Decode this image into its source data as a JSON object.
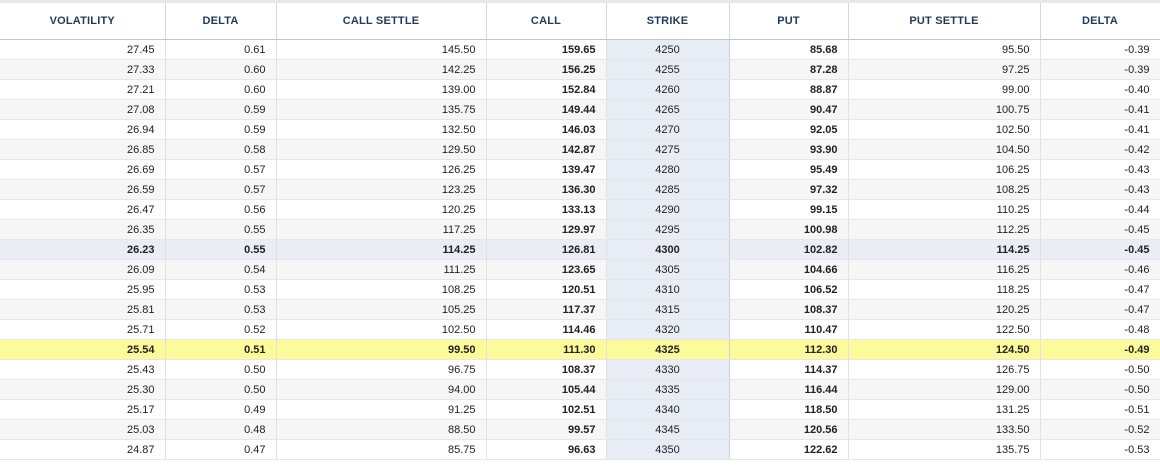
{
  "columns": [
    "VOLATILITY",
    "DELTA",
    "CALL SETTLE",
    "CALL",
    "STRIKE",
    "PUT",
    "PUT SETTLE",
    "DELTA"
  ],
  "rows": [
    {
      "volatility": "27.45",
      "call_delta": "0.61",
      "call_settle": "145.50",
      "call": "159.65",
      "strike": "4250",
      "put": "85.68",
      "put_settle": "95.50",
      "put_delta": "-0.39"
    },
    {
      "volatility": "27.33",
      "call_delta": "0.60",
      "call_settle": "142.25",
      "call": "156.25",
      "strike": "4255",
      "put": "87.28",
      "put_settle": "97.25",
      "put_delta": "-0.39"
    },
    {
      "volatility": "27.21",
      "call_delta": "0.60",
      "call_settle": "139.00",
      "call": "152.84",
      "strike": "4260",
      "put": "88.87",
      "put_settle": "99.00",
      "put_delta": "-0.40"
    },
    {
      "volatility": "27.08",
      "call_delta": "0.59",
      "call_settle": "135.75",
      "call": "149.44",
      "strike": "4265",
      "put": "90.47",
      "put_settle": "100.75",
      "put_delta": "-0.41"
    },
    {
      "volatility": "26.94",
      "call_delta": "0.59",
      "call_settle": "132.50",
      "call": "146.03",
      "strike": "4270",
      "put": "92.05",
      "put_settle": "102.50",
      "put_delta": "-0.41"
    },
    {
      "volatility": "26.85",
      "call_delta": "0.58",
      "call_settle": "129.50",
      "call": "142.87",
      "strike": "4275",
      "put": "93.90",
      "put_settle": "104.50",
      "put_delta": "-0.42"
    },
    {
      "volatility": "26.69",
      "call_delta": "0.57",
      "call_settle": "126.25",
      "call": "139.47",
      "strike": "4280",
      "put": "95.49",
      "put_settle": "106.25",
      "put_delta": "-0.43"
    },
    {
      "volatility": "26.59",
      "call_delta": "0.57",
      "call_settle": "123.25",
      "call": "136.30",
      "strike": "4285",
      "put": "97.32",
      "put_settle": "108.25",
      "put_delta": "-0.43"
    },
    {
      "volatility": "26.47",
      "call_delta": "0.56",
      "call_settle": "120.25",
      "call": "133.13",
      "strike": "4290",
      "put": "99.15",
      "put_settle": "110.25",
      "put_delta": "-0.44"
    },
    {
      "volatility": "26.35",
      "call_delta": "0.55",
      "call_settle": "117.25",
      "call": "129.97",
      "strike": "4295",
      "put": "100.98",
      "put_settle": "112.25",
      "put_delta": "-0.45"
    },
    {
      "volatility": "26.23",
      "call_delta": "0.55",
      "call_settle": "114.25",
      "call": "126.81",
      "strike": "4300",
      "put": "102.82",
      "put_settle": "114.25",
      "put_delta": "-0.45",
      "style": "atm"
    },
    {
      "volatility": "26.09",
      "call_delta": "0.54",
      "call_settle": "111.25",
      "call": "123.65",
      "strike": "4305",
      "put": "104.66",
      "put_settle": "116.25",
      "put_delta": "-0.46"
    },
    {
      "volatility": "25.95",
      "call_delta": "0.53",
      "call_settle": "108.25",
      "call": "120.51",
      "strike": "4310",
      "put": "106.52",
      "put_settle": "118.25",
      "put_delta": "-0.47"
    },
    {
      "volatility": "25.81",
      "call_delta": "0.53",
      "call_settle": "105.25",
      "call": "117.37",
      "strike": "4315",
      "put": "108.37",
      "put_settle": "120.25",
      "put_delta": "-0.47"
    },
    {
      "volatility": "25.71",
      "call_delta": "0.52",
      "call_settle": "102.50",
      "call": "114.46",
      "strike": "4320",
      "put": "110.47",
      "put_settle": "122.50",
      "put_delta": "-0.48"
    },
    {
      "volatility": "25.54",
      "call_delta": "0.51",
      "call_settle": "99.50",
      "call": "111.30",
      "strike": "4325",
      "put": "112.30",
      "put_settle": "124.50",
      "put_delta": "-0.49",
      "style": "highlight"
    },
    {
      "volatility": "25.43",
      "call_delta": "0.50",
      "call_settle": "96.75",
      "call": "108.37",
      "strike": "4330",
      "put": "114.37",
      "put_settle": "126.75",
      "put_delta": "-0.50"
    },
    {
      "volatility": "25.30",
      "call_delta": "0.50",
      "call_settle": "94.00",
      "call": "105.44",
      "strike": "4335",
      "put": "116.44",
      "put_settle": "129.00",
      "put_delta": "-0.50"
    },
    {
      "volatility": "25.17",
      "call_delta": "0.49",
      "call_settle": "91.25",
      "call": "102.51",
      "strike": "4340",
      "put": "118.50",
      "put_settle": "131.25",
      "put_delta": "-0.51"
    },
    {
      "volatility": "25.03",
      "call_delta": "0.48",
      "call_settle": "88.50",
      "call": "99.57",
      "strike": "4345",
      "put": "120.56",
      "put_settle": "133.50",
      "put_delta": "-0.52"
    },
    {
      "volatility": "24.87",
      "call_delta": "0.47",
      "call_settle": "85.75",
      "call": "96.63",
      "strike": "4350",
      "put": "122.62",
      "put_settle": "135.75",
      "put_delta": "-0.53"
    }
  ],
  "colors": {
    "header_text": "#1f3a5c",
    "strike_column": "#e8edf5",
    "atm_row": "#e9eef6",
    "highlight_row": "#fbfb9a",
    "alt_row": "#f6f6f6"
  }
}
